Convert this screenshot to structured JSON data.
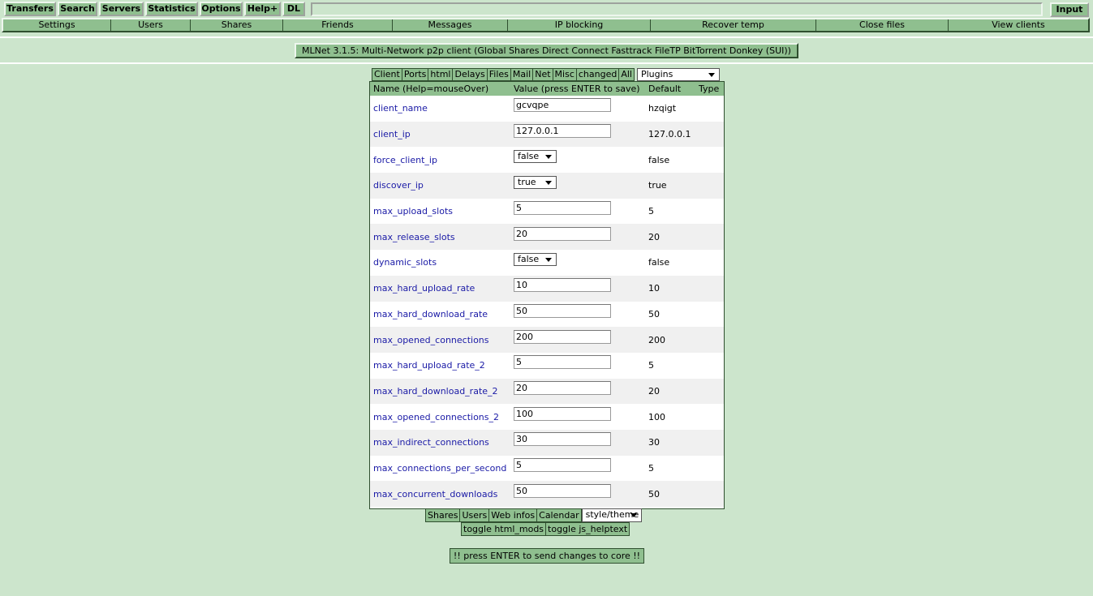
{
  "toolbar": {
    "buttons": [
      "Transfers",
      "Search",
      "Servers",
      "Statistics",
      "Options",
      "Help+",
      "DL"
    ],
    "input_label": "Input"
  },
  "submenu": [
    "Settings",
    "Users",
    "Shares",
    "Friends",
    "Messages",
    "IP blocking",
    "Recover temp",
    "Close files",
    "View clients"
  ],
  "title": "MLNet 3.1.5: Multi-Network p2p client (Global Shares Direct Connect Fasttrack FileTP BitTorrent Donkey (SUI))",
  "tabs": [
    "Client",
    "Ports",
    "html",
    "Delays",
    "Files",
    "Mail",
    "Net",
    "Misc",
    "changed",
    "All"
  ],
  "plugins_select": "Plugins",
  "table": {
    "headers": {
      "name": "Name (Help=mouseOver)",
      "value": "Value (press ENTER to save)",
      "default": "Default",
      "type": "Type"
    },
    "rows": [
      {
        "name": "client_name",
        "value": "gcvqpe",
        "default": "hzqigt",
        "kind": "text"
      },
      {
        "name": "client_ip",
        "value": "127.0.0.1",
        "default": "127.0.0.1",
        "kind": "text"
      },
      {
        "name": "force_client_ip",
        "value": "false",
        "default": "false",
        "kind": "bool"
      },
      {
        "name": "discover_ip",
        "value": "true",
        "default": "true",
        "kind": "bool"
      },
      {
        "name": "max_upload_slots",
        "value": "5",
        "default": "5",
        "kind": "text"
      },
      {
        "name": "max_release_slots",
        "value": "20",
        "default": "20",
        "kind": "text"
      },
      {
        "name": "dynamic_slots",
        "value": "false",
        "default": "false",
        "kind": "bool"
      },
      {
        "name": "max_hard_upload_rate",
        "value": "10",
        "default": "10",
        "kind": "text"
      },
      {
        "name": "max_hard_download_rate",
        "value": "50",
        "default": "50",
        "kind": "text"
      },
      {
        "name": "max_opened_connections",
        "value": "200",
        "default": "200",
        "kind": "text"
      },
      {
        "name": "max_hard_upload_rate_2",
        "value": "5",
        "default": "5",
        "kind": "text"
      },
      {
        "name": "max_hard_download_rate_2",
        "value": "20",
        "default": "20",
        "kind": "text"
      },
      {
        "name": "max_opened_connections_2",
        "value": "100",
        "default": "100",
        "kind": "text"
      },
      {
        "name": "max_indirect_connections",
        "value": "30",
        "default": "30",
        "kind": "text"
      },
      {
        "name": "max_connections_per_second",
        "value": "5",
        "default": "5",
        "kind": "text"
      },
      {
        "name": "max_concurrent_downloads",
        "value": "50",
        "default": "50",
        "kind": "text"
      }
    ]
  },
  "bottom_tabs": [
    "Shares",
    "Users",
    "Web infos",
    "Calendar"
  ],
  "style_select": "style/theme",
  "toggles": [
    "toggle html_mods",
    "toggle js_helptext"
  ],
  "enter_note": "!! press ENTER to send changes to core !!",
  "colors": {
    "background": "#cce5cc",
    "button": "#8fbf8f",
    "link": "#1a1aa6",
    "row_alt": "#f0f0f0"
  }
}
